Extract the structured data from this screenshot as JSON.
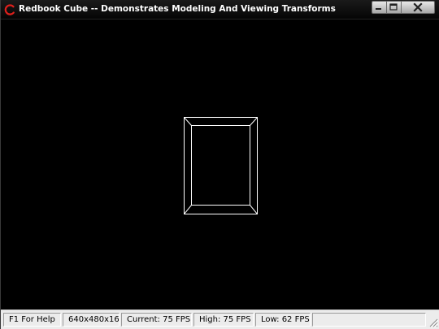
{
  "window": {
    "title": "Redbook Cube -- Demonstrates Modeling And Viewing Transforms",
    "icon": "nehe-swirl-icon",
    "caption_buttons": [
      "minimize-icon",
      "maximize-icon",
      "close-icon"
    ]
  },
  "viewport": {
    "background": "#000000",
    "wire_color": "#ffffff",
    "content": "wireframe-cube"
  },
  "statusbar": {
    "help": "F1 For Help",
    "resolution": "640x480x16",
    "current_fps": "Current: 75 FPS",
    "high_fps": "High: 75 FPS",
    "low_fps": "Low: 62 FPS"
  },
  "colors": {
    "title_bg": "#0a0a0a",
    "title_text": "#ffffff",
    "icon_red": "#e0201c",
    "statusbar_bg": "#ececec"
  }
}
